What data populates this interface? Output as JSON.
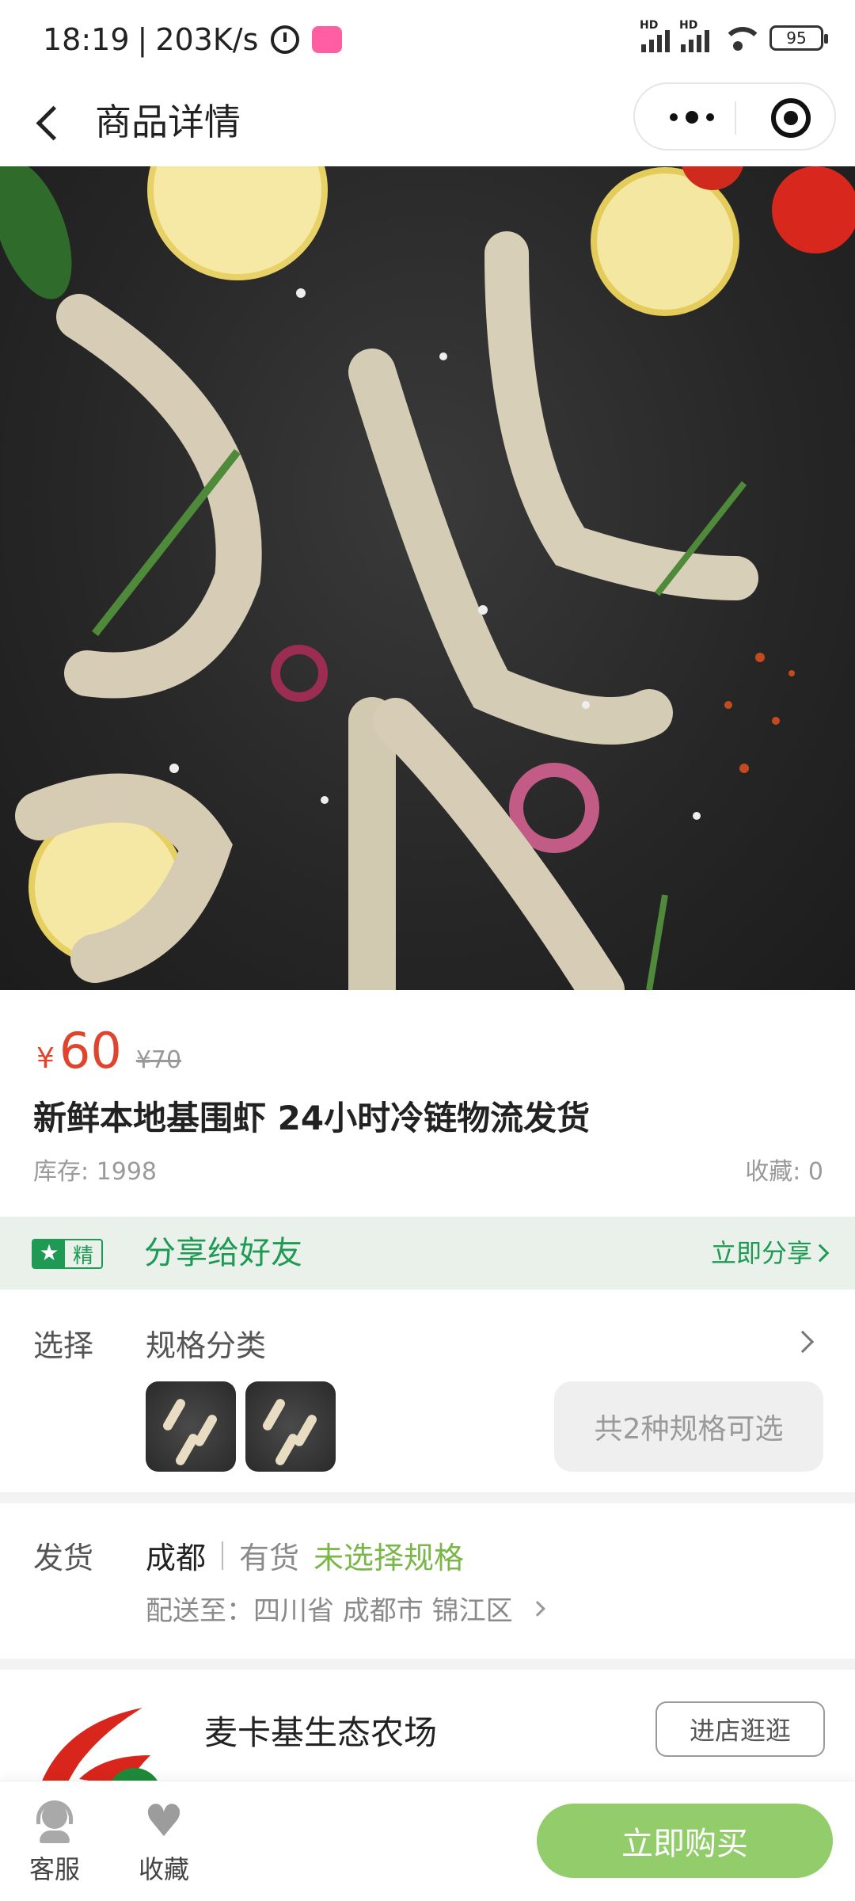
{
  "status_bar": {
    "time": "18:19",
    "speed": "203K/s",
    "battery": "95",
    "hd1": "HD",
    "hd2": "HD"
  },
  "nav": {
    "title": "商品详情"
  },
  "product": {
    "currency": "¥",
    "price": "60",
    "original_price": "¥70",
    "title": "新鲜本地基围虾 24小时冷链物流发货",
    "stock": "库存: 1998",
    "favorites": "收藏: 0"
  },
  "share": {
    "badge_text": "精",
    "title": "分享给好友",
    "action": "立即分享"
  },
  "spec": {
    "label": "选择",
    "title": "规格分类",
    "count_label": "共2种规格可选"
  },
  "delivery": {
    "label": "发货",
    "city": "成都",
    "stock_status": "有货",
    "selection_status": "未选择规格",
    "address": "配送至：四川省 成都市 锦江区"
  },
  "shop": {
    "name": "麦卡基生态农场",
    "enter_label": "进店逛逛"
  },
  "bottom_bar": {
    "service_label": "客服",
    "favorite_label": "收藏",
    "buy_label": "立即购买"
  },
  "colors": {
    "price_red": "#e0442c",
    "brand_green": "#1e9a54",
    "buy_button_green": "#93cc6a",
    "unselected_green": "#7ab648"
  },
  "icons": [
    "back-icon",
    "more-icon",
    "target-icon",
    "alarm-icon",
    "wifi-icon",
    "battery-icon",
    "star-icon",
    "chevron-right-icon",
    "headset-icon",
    "heart-icon"
  ]
}
